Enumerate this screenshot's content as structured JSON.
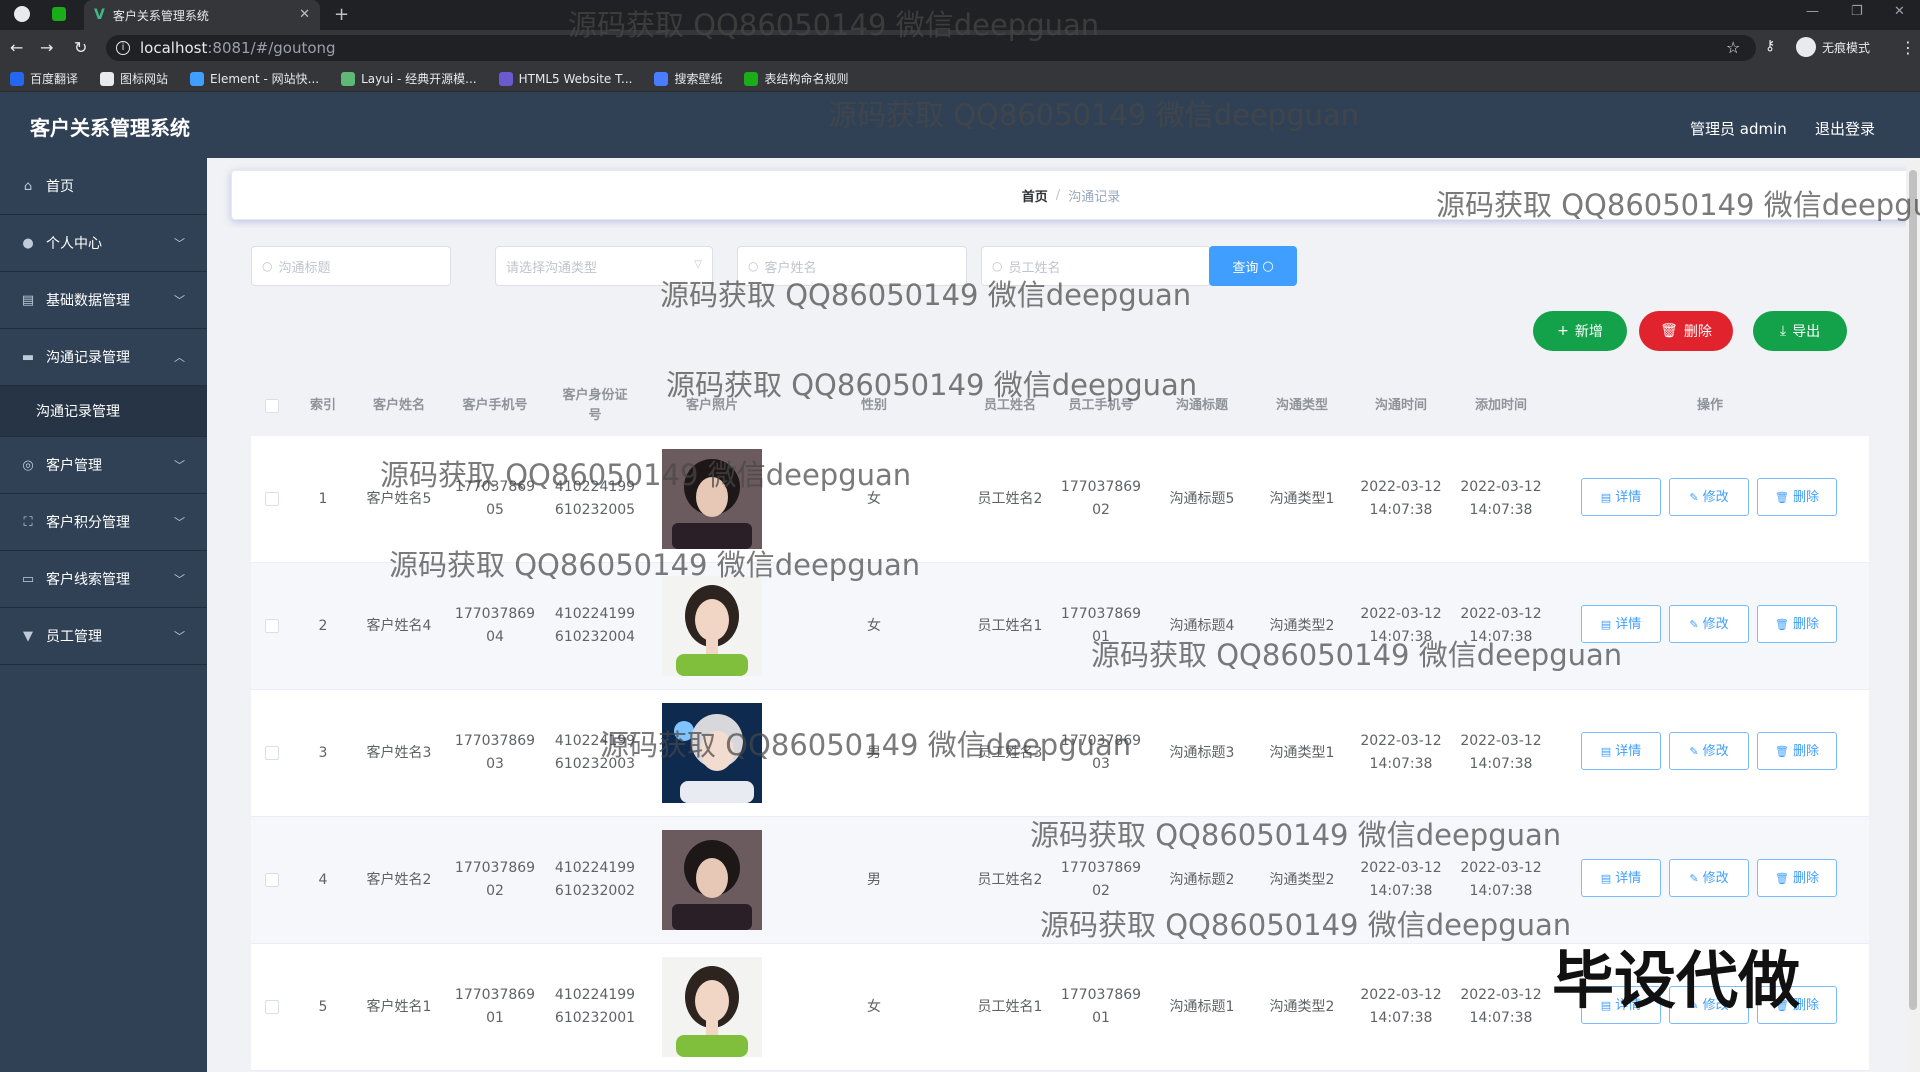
{
  "browser": {
    "tab_title": "客户关系管理系统",
    "url_host": "localhost",
    "url_path": ":8081/#/goutong",
    "incognito_label": "无痕模式",
    "bookmarks": [
      {
        "label": "百度翻译",
        "color": "#2468f2"
      },
      {
        "label": "图标网站",
        "color": "#e8eaed"
      },
      {
        "label": "Element - 网站快...",
        "color": "#409eff"
      },
      {
        "label": "Layui - 经典开源模...",
        "color": "#5fb878"
      },
      {
        "label": "HTML5 Website T...",
        "color": "#6a5acd"
      },
      {
        "label": "搜索壁纸",
        "color": "#4a7cff"
      },
      {
        "label": "表结构命名规则",
        "color": "#1aad19"
      }
    ]
  },
  "header": {
    "app_title": "客户关系管理系统",
    "user_label": "管理员 admin",
    "logout_label": "退出登录"
  },
  "sidebar": {
    "items": [
      {
        "label": "首页",
        "icon": "home-icon"
      },
      {
        "label": "个人中心",
        "icon": "user-icon"
      },
      {
        "label": "基础数据管理",
        "icon": "database-icon"
      },
      {
        "label": "沟通记录管理",
        "icon": "message-icon",
        "sub": "沟通记录管理"
      },
      {
        "label": "客户管理",
        "icon": "customer-icon"
      },
      {
        "label": "客户积分管理",
        "icon": "points-icon"
      },
      {
        "label": "客户线索管理",
        "icon": "clue-icon"
      },
      {
        "label": "员工管理",
        "icon": "staff-icon"
      }
    ]
  },
  "breadcrumb": {
    "home": "首页",
    "current": "沟通记录"
  },
  "search": {
    "title_placeholder": "沟通标题",
    "type_placeholder": "请选择沟通类型",
    "customer_placeholder": "客户姓名",
    "staff_placeholder": "员工姓名",
    "query_label": "查询"
  },
  "actions": {
    "add_label": "新增",
    "delete_label": "删除",
    "export_label": "导出"
  },
  "table": {
    "headers": [
      "索引",
      "客户姓名",
      "客户手机号",
      "客户身份证号",
      "客户照片",
      "性别",
      "员工姓名",
      "员工手机号",
      "沟通标题",
      "沟通类型",
      "沟通时间",
      "添加时间",
      "操作"
    ],
    "id_header_lines": [
      "客户身份证",
      "号"
    ],
    "op_labels": {
      "detail": "详情",
      "edit": "修改",
      "delete": "删除"
    },
    "rows": [
      {
        "index": "1",
        "customer": "客户姓名5",
        "phone": [
          "177037869",
          "05"
        ],
        "idcard": [
          "410224199",
          "610232005"
        ],
        "gender": "女",
        "staff": "员工姓名2",
        "staff_phone": [
          "177037869",
          "02"
        ],
        "title": "沟通标题5",
        "type": "沟通类型1",
        "comm_time": [
          "2022-03-12",
          "14:07:38"
        ],
        "add_time": [
          "2022-03-12",
          "14:07:38"
        ],
        "photo": "man"
      },
      {
        "index": "2",
        "customer": "客户姓名4",
        "phone": [
          "177037869",
          "04"
        ],
        "idcard": [
          "410224199",
          "610232004"
        ],
        "gender": "女",
        "staff": "员工姓名1",
        "staff_phone": [
          "177037869",
          "01"
        ],
        "title": "沟通标题4",
        "type": "沟通类型2",
        "comm_time": [
          "2022-03-12",
          "14:07:38"
        ],
        "add_time": [
          "2022-03-12",
          "14:07:38"
        ],
        "photo": "woman"
      },
      {
        "index": "3",
        "customer": "客户姓名3",
        "phone": [
          "177037869",
          "03"
        ],
        "idcard": [
          "410224199",
          "610232003"
        ],
        "gender": "男",
        "staff": "员工姓名3",
        "staff_phone": [
          "177037869",
          "03"
        ],
        "title": "沟通标题3",
        "type": "沟通类型1",
        "comm_time": [
          "2022-03-12",
          "14:07:38"
        ],
        "add_time": [
          "2022-03-12",
          "14:07:38"
        ],
        "photo": "blue"
      },
      {
        "index": "4",
        "customer": "客户姓名2",
        "phone": [
          "177037869",
          "02"
        ],
        "idcard": [
          "410224199",
          "610232002"
        ],
        "gender": "男",
        "staff": "员工姓名2",
        "staff_phone": [
          "177037869",
          "02"
        ],
        "title": "沟通标题2",
        "type": "沟通类型2",
        "comm_time": [
          "2022-03-12",
          "14:07:38"
        ],
        "add_time": [
          "2022-03-12",
          "14:07:38"
        ],
        "photo": "man"
      },
      {
        "index": "5",
        "customer": "客户姓名1",
        "phone": [
          "177037869",
          "01"
        ],
        "idcard": [
          "410224199",
          "610232001"
        ],
        "gender": "女",
        "staff": "员工姓名1",
        "staff_phone": [
          "177037869",
          "01"
        ],
        "title": "沟通标题1",
        "type": "沟通类型2",
        "comm_time": [
          "2022-03-12",
          "14:07:38"
        ],
        "add_time": [
          "2022-03-12",
          "14:07:38"
        ],
        "photo": "woman"
      }
    ]
  },
  "watermark": {
    "text": "源码获取 QQ86050149 微信deepguan",
    "big_text": "毕设代做"
  }
}
